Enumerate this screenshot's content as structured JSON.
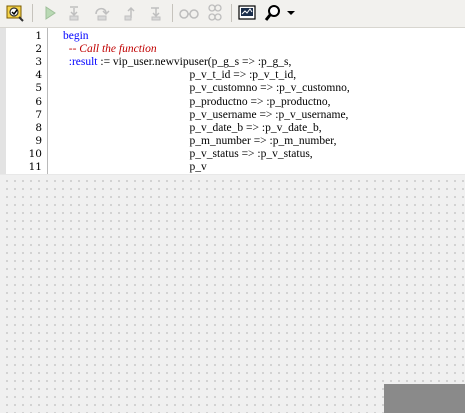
{
  "toolbar": {
    "buttons": [
      {
        "name": "compile-icon"
      },
      {
        "name": "execute-icon"
      },
      {
        "name": "step-into-icon"
      },
      {
        "name": "step-over-icon"
      },
      {
        "name": "step-out-icon"
      },
      {
        "name": "run-to-exception-icon"
      },
      {
        "name": "toggle-breakpoint-icon"
      },
      {
        "name": "add-watch-icon"
      },
      {
        "name": "output-window-icon"
      },
      {
        "name": "find-icon"
      },
      {
        "name": "dropdown-arrow-icon"
      }
    ]
  },
  "editor": {
    "line_numbers": [
      "1",
      "2",
      "3",
      "4",
      "5",
      "6",
      "7",
      "8",
      "9",
      "10",
      "11"
    ],
    "lines": [
      [
        {
          "t": "begin",
          "c": "kw"
        }
      ],
      [
        {
          "t": "  -- Call the function",
          "c": "cmt"
        }
      ],
      [
        {
          "t": "  :result",
          "c": "bind"
        },
        {
          "t": " := vip_user.newvipuser(p_g_s => :p_g_s,",
          "c": ""
        }
      ],
      [
        {
          "t": "                                            p_v_t_id => :p_v_t_id,",
          "c": ""
        }
      ],
      [
        {
          "t": "                                            p_v_customno => :p_v_customno,",
          "c": ""
        }
      ],
      [
        {
          "t": "                                            p_productno => :p_productno,",
          "c": ""
        }
      ],
      [
        {
          "t": "                                            p_v_username => :p_v_username,",
          "c": ""
        }
      ],
      [
        {
          "t": "                                            p_v_date_b => :p_v_date_b,",
          "c": ""
        }
      ],
      [
        {
          "t": "                                            p_m_number => :p_m_number,",
          "c": ""
        }
      ],
      [
        {
          "t": "                                            p_v_status => :p_v_status,",
          "c": ""
        }
      ],
      [
        {
          "t": "                                            p_v",
          "c": ""
        }
      ]
    ]
  },
  "colors": {
    "keyword": "#0000ff",
    "comment": "#c00000",
    "text": "#000000",
    "background": "#ffffff"
  }
}
